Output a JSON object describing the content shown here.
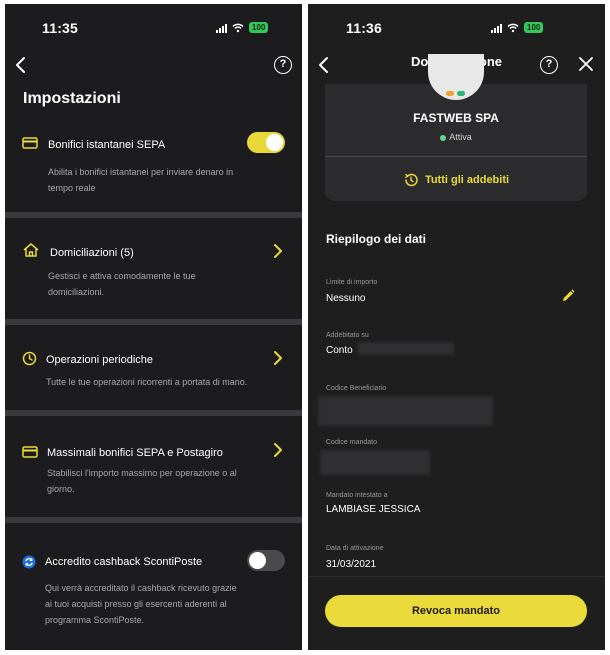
{
  "left_screen": {
    "status": {
      "time": "11:35",
      "battery": "100"
    },
    "title": "Impostazioni",
    "rows": [
      {
        "title": "Bonifici istantanei SEPA",
        "description": "Abilita i bonifici istantanei per inviare denaro in tempo reale",
        "icon": "card-icon",
        "control": "toggle",
        "toggle_on": true
      },
      {
        "title": "Domiciliazioni (5)",
        "description": "Gestisci e attiva comodamente le tue domiciliazioni.",
        "icon": "home-icon",
        "control": "chevron"
      },
      {
        "title": "Operazioni periodiche",
        "description": "Tutte le tue operazioni ricorrenti a portata di mano.",
        "icon": "clock-icon",
        "control": "chevron"
      },
      {
        "title": "Massimali bonifici SEPA e Postagiro",
        "description": "Stabilisci l'importo massimo per operazione o al giorno.",
        "icon": "card-icon",
        "control": "chevron"
      },
      {
        "title": "Accredito cashback ScontiPoste",
        "description": "Qui verrà accreditato il cashback ricevuto grazie ai tuoi acquisti presso gli esercenti aderenti al programma ScontiPoste.",
        "icon": "sync-icon",
        "control": "toggle",
        "toggle_on": false
      }
    ]
  },
  "right_screen": {
    "status": {
      "time": "11:36",
      "battery": "100"
    },
    "header_title": "Domiciliazione",
    "card": {
      "company": "FASTWEB SPA",
      "state": "Attiva",
      "link": "Tutti gli addebiti"
    },
    "section_title": "Riepilogo dei dati",
    "fields": [
      {
        "label": "Limite di importo",
        "value": "Nessuno"
      },
      {
        "label": "Addebitato su",
        "value": "Conto"
      },
      {
        "label": "Codice Beneficiario",
        "value": ""
      },
      {
        "label": "Codice mandato",
        "value": ""
      },
      {
        "label": "Mandato intestato a",
        "value": "LAMBIASE JESSICA"
      },
      {
        "label": "Data di attivazione",
        "value": "31/03/2021"
      }
    ],
    "cta": "Revoca mandato"
  },
  "colors": {
    "background": "#1c1c1e",
    "accent_yellow": "#eadb3a",
    "separator": "#3a3a3c",
    "battery_green": "#34c759"
  }
}
